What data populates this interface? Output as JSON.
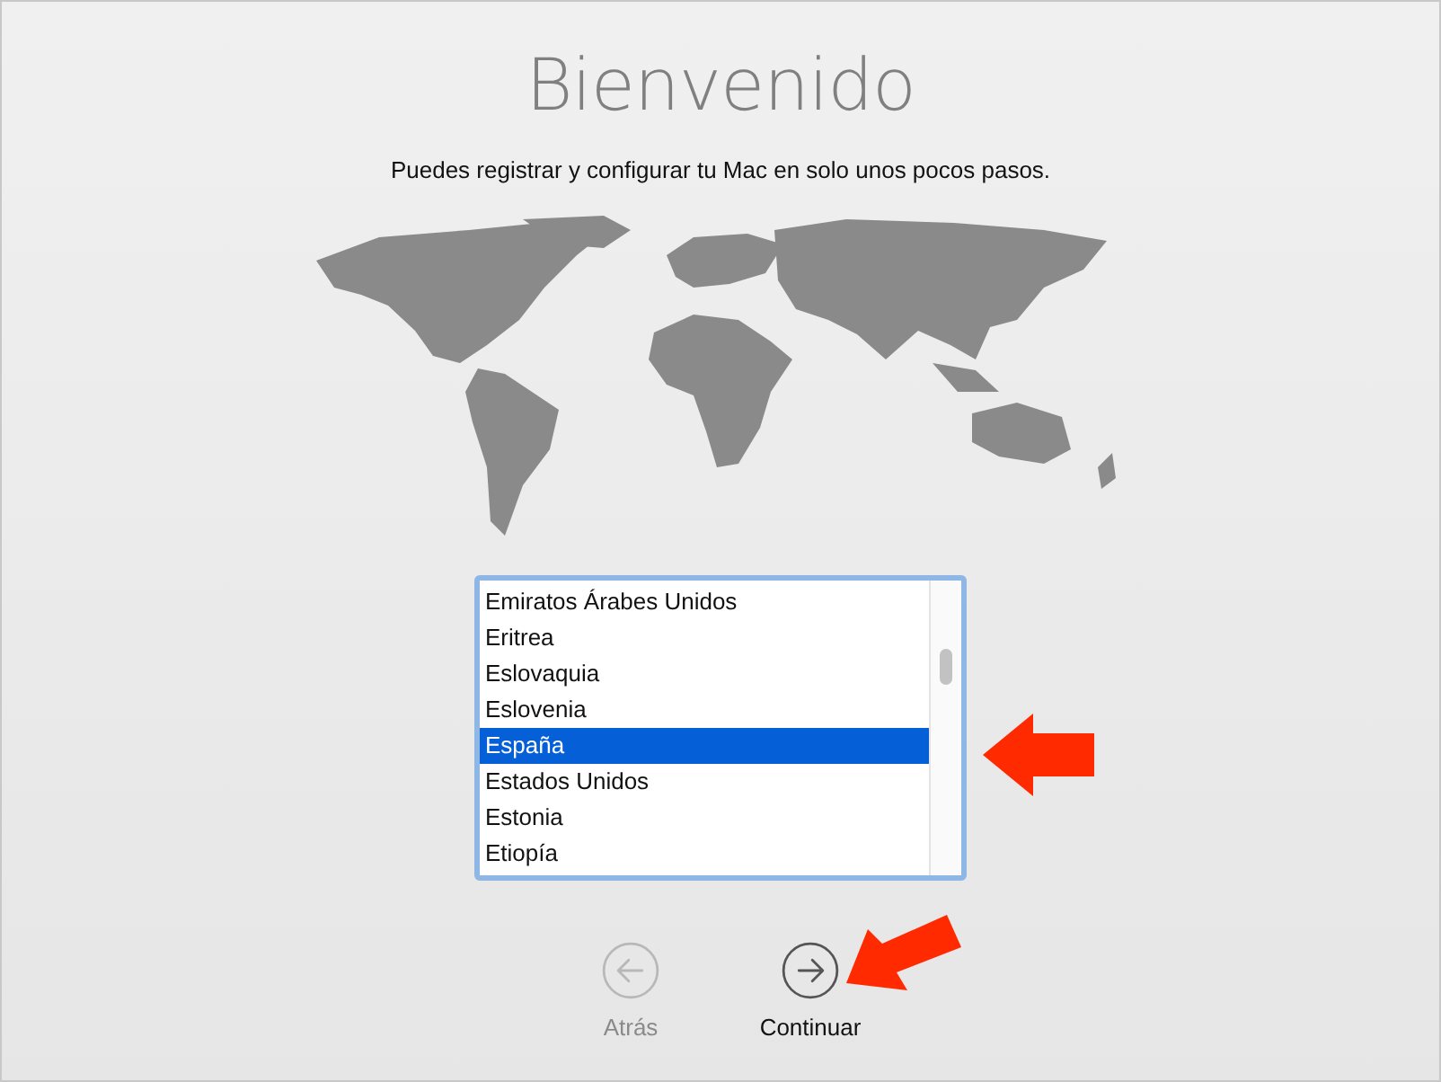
{
  "title": "Bienvenido",
  "subtitle": "Puedes registrar y configurar tu Mac en solo unos pocos pasos.",
  "country_list": {
    "items": [
      {
        "label": "Emiratos Árabes Unidos",
        "selected": false
      },
      {
        "label": "Eritrea",
        "selected": false
      },
      {
        "label": "Eslovaquia",
        "selected": false
      },
      {
        "label": "Eslovenia",
        "selected": false
      },
      {
        "label": "España",
        "selected": true
      },
      {
        "label": "Estados Unidos",
        "selected": false
      },
      {
        "label": "Estonia",
        "selected": false
      },
      {
        "label": "Etiopía",
        "selected": false
      }
    ]
  },
  "buttons": [
    {
      "kind": "back",
      "label": "Atrás",
      "disabled": true
    },
    {
      "kind": "forward",
      "label": "Continuar",
      "disabled": false
    }
  ]
}
